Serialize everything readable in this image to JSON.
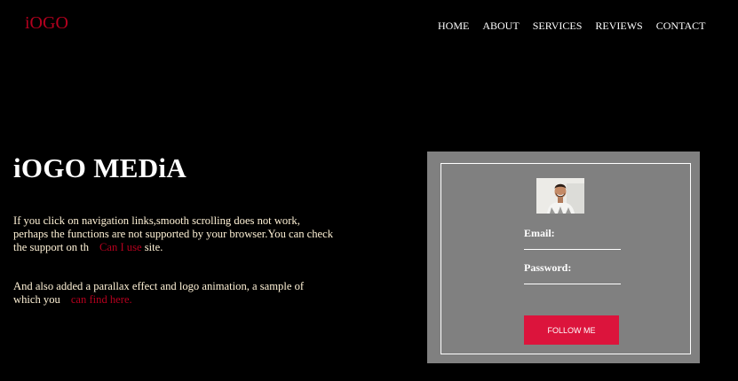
{
  "header": {
    "logo": "iOGO",
    "nav": [
      "HOME",
      "ABOUT",
      "SERVICES",
      "REVIEWS",
      "CONTACT"
    ]
  },
  "hero": {
    "title": "iOGO MEDiA",
    "paragraph1_text": "If you click on navigation links,smooth scrolling does not work, perhaps the functions are not supported by your browser.You can check the support on th",
    "paragraph1_link": "Can I use",
    "paragraph1_tail": "site.",
    "paragraph2_text": "And also added a parallax effect and logo animation, a sample of which you",
    "paragraph2_link": "can find here."
  },
  "form": {
    "avatar_icon": "person-photo",
    "email_label": "Email:",
    "password_label": "Password:",
    "button_label": "FOLLOW ME"
  },
  "colors": {
    "background": "#000000",
    "accent": "#b4001e",
    "button": "#dc143c",
    "panel": "#808080"
  }
}
